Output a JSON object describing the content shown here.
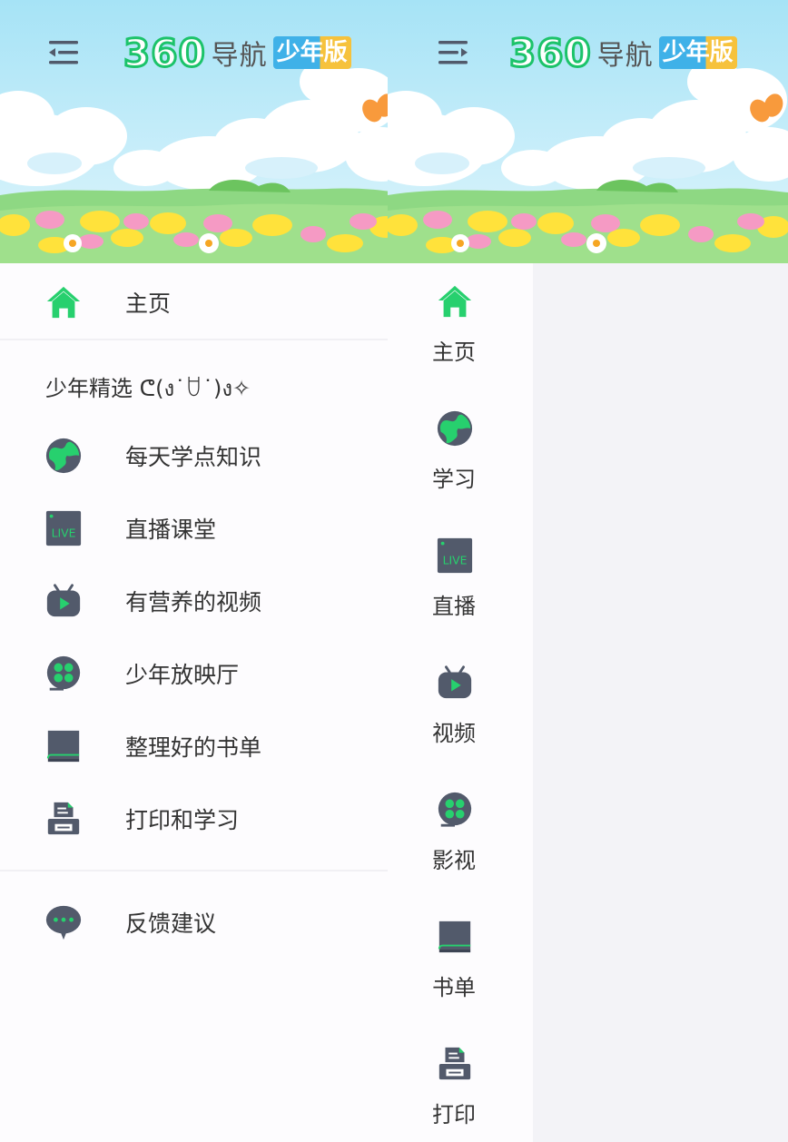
{
  "colors": {
    "brand_green": "#1cc36a",
    "icon_slate": "#525a6b",
    "icon_green": "#27d06e",
    "sky_top": "#a6e3f6",
    "panel_bg": "#fdfcfe",
    "page_bg": "#f3f3f7"
  },
  "header": {
    "logo_number": "360",
    "logo_text": "导航",
    "logo_badge": "少年版"
  },
  "menu": {
    "home": {
      "label": "主页",
      "icon": "home-icon"
    },
    "section_title": "少年精选 ᕦ(ง˙ꇴ˙)ง✧",
    "items": [
      {
        "label": "每天学点知识",
        "icon": "globe-icon"
      },
      {
        "label": "直播课堂",
        "icon": "live-icon"
      },
      {
        "label": "有营养的视频",
        "icon": "tv-play-icon"
      },
      {
        "label": "少年放映厅",
        "icon": "film-reel-icon"
      },
      {
        "label": "整理好的书单",
        "icon": "book-icon"
      },
      {
        "label": "打印和学习",
        "icon": "printer-icon"
      }
    ],
    "feedback": {
      "label": "反馈建议",
      "icon": "chat-bubble-icon"
    }
  },
  "rail": {
    "items": [
      {
        "label": "主页",
        "icon": "home-icon"
      },
      {
        "label": "学习",
        "icon": "globe-icon"
      },
      {
        "label": "直播",
        "icon": "live-icon"
      },
      {
        "label": "视频",
        "icon": "tv-play-icon"
      },
      {
        "label": "影视",
        "icon": "film-reel-icon"
      },
      {
        "label": "书单",
        "icon": "book-icon"
      },
      {
        "label": "打印",
        "icon": "printer-icon"
      }
    ]
  }
}
